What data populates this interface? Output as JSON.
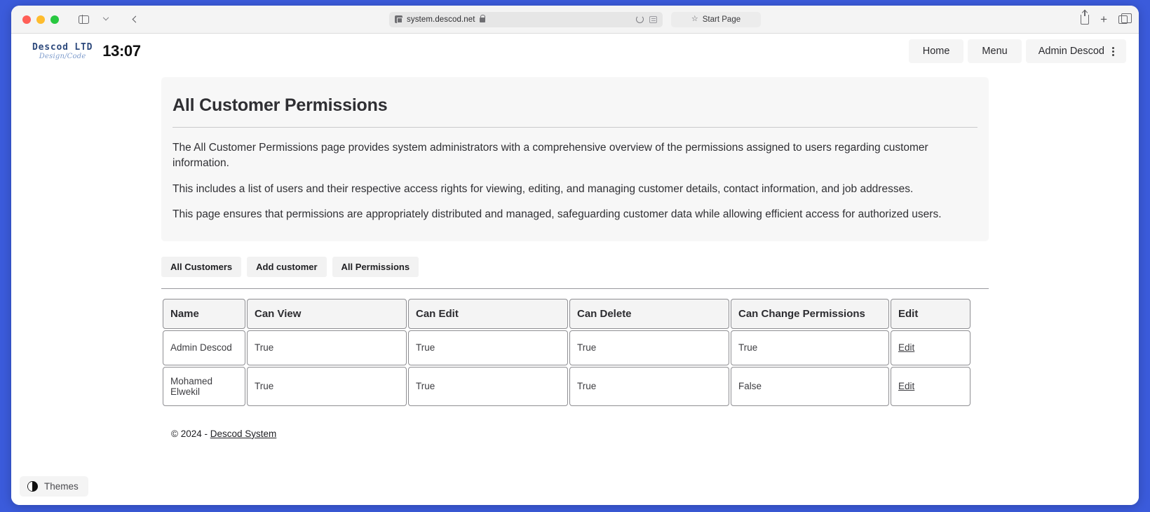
{
  "browser": {
    "url": "system.descod.net",
    "start_page_label": "Start Page",
    "icons": {
      "sidebar": "sidebar-toggle-icon",
      "chevron_down": "chevron-down-icon",
      "back": "back-chevron-icon",
      "shield": "privacy-shield-icon",
      "lock": "lock-icon",
      "reload": "reload-icon",
      "reader": "reader-view-icon",
      "star": "★",
      "share": "share-icon",
      "plus": "+",
      "tabs": "tab-overview-icon"
    }
  },
  "navbar": {
    "logo_main": "Descod LTD",
    "logo_sub": "Design/Code",
    "clock": "13:07",
    "links": [
      {
        "label": "Home"
      },
      {
        "label": "Menu"
      }
    ],
    "user": "Admin Descod"
  },
  "page": {
    "title": "All Customer Permissions",
    "paragraphs": [
      "The All Customer Permissions page provides system administrators with a comprehensive overview of the permissions assigned to users regarding customer information.",
      "This includes a list of users and their respective access rights for viewing, editing, and managing customer details, contact information, and job addresses.",
      "This page ensures that permissions are appropriately distributed and managed, safeguarding customer data while allowing efficient access for authorized users."
    ],
    "buttons": [
      {
        "label": "All Customers"
      },
      {
        "label": "Add customer"
      },
      {
        "label": "All Permissions"
      }
    ]
  },
  "table": {
    "columns": [
      "Name",
      "Can View",
      "Can Edit",
      "Can Delete",
      "Can Change Permissions",
      "Edit"
    ],
    "rows": [
      {
        "name": "Admin Descod",
        "can_view": "True",
        "can_edit": "True",
        "can_delete": "True",
        "can_change_permissions": "True",
        "edit_label": "Edit"
      },
      {
        "name": "Mohamed Elwekil",
        "can_view": "True",
        "can_edit": "True",
        "can_delete": "True",
        "can_change_permissions": "False",
        "edit_label": "Edit"
      }
    ]
  },
  "footer": {
    "copyright": "© 2024 - ",
    "link": "Descod System"
  },
  "themes": {
    "label": "Themes"
  },
  "colors": {
    "desktop_accent": "#3b5bdb",
    "card_bg": "#f7f7f7",
    "logo_blue": "#2e4a7d",
    "logo_script": "#7e9ccc"
  }
}
